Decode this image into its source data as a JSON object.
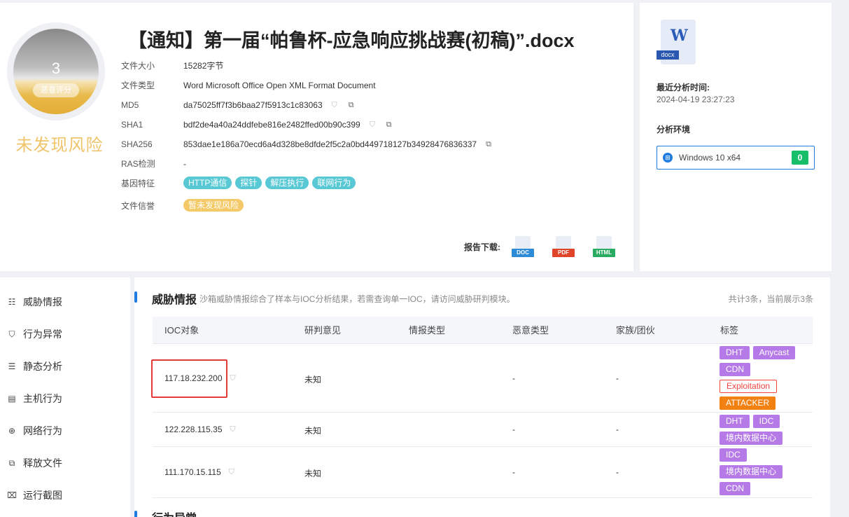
{
  "score": {
    "value": "3",
    "tag": "恶意评分",
    "verdict": "未发现风险"
  },
  "file": {
    "title": "【通知】第一届“帕鲁杯-应急响应挑战赛(初稿)”.docx",
    "rows": [
      {
        "label": "文件大小",
        "value": "15282字节"
      },
      {
        "label": "文件类型",
        "value": "Word Microsoft Office Open XML Format Document"
      },
      {
        "label": "MD5",
        "value": "da75025ff7f3b6baa27f5913c1c83063"
      },
      {
        "label": "SHA1",
        "value": "bdf2de4a40a24ddfebe816e2482ffed00b90c399"
      },
      {
        "label": "SHA256",
        "value": "853dae1e186a70ecd6a4d328be8dfde2f5c2a0bd449718127b34928476836337"
      },
      {
        "label": "RAS检测",
        "value": "-"
      }
    ],
    "gene_label": "基因特征",
    "gene_tags": [
      "HTTP通信",
      "探针",
      "解压执行",
      "联网行为"
    ],
    "reputation_label": "文件信誉",
    "reputation_tag": "暂未发现风险"
  },
  "download": {
    "label": "报告下载:",
    "formats": [
      {
        "name": "DOC",
        "color": "#2e8bd6"
      },
      {
        "name": "PDF",
        "color": "#e0452a"
      },
      {
        "name": "HTML",
        "color": "#2aab62"
      }
    ]
  },
  "right": {
    "doc_letter": "W",
    "doc_ext": "docx",
    "recent_label": "最近分析时间:",
    "recent_time": "2024-04-19 23:27:23",
    "env_label": "分析环境",
    "env_name": "Windows 10 x64",
    "env_count": "0"
  },
  "sidebar": {
    "items": [
      {
        "label": "威胁情报",
        "icon": "threat-intel-icon",
        "glyph": "☷"
      },
      {
        "label": "行为异常",
        "icon": "shield-icon",
        "glyph": "⛉"
      },
      {
        "label": "静态分析",
        "icon": "static-analysis-icon",
        "glyph": "☰"
      },
      {
        "label": "主机行为",
        "icon": "host-icon",
        "glyph": "▤"
      },
      {
        "label": "网络行为",
        "icon": "network-icon",
        "glyph": "⊕"
      },
      {
        "label": "释放文件",
        "icon": "release-file-icon",
        "glyph": "⧉"
      },
      {
        "label": "运行截图",
        "icon": "screenshot-icon",
        "glyph": "⌧"
      }
    ]
  },
  "threat": {
    "title": "威胁情报",
    "desc": "沙箱威胁情报综合了样本与IOC分析结果，若需查询单一IOC，请访问威胁研判模块。",
    "count": "共计3条，当前展示3条",
    "columns": [
      "IOC对象",
      "研判意见",
      "情报类型",
      "恶意类型",
      "家族/团伙",
      "标签"
    ],
    "rows": [
      {
        "ioc": "117.18.232.200",
        "opinion": "未知",
        "intel": "",
        "malicious": "-",
        "family": "-",
        "tags": [
          {
            "text": "DHT",
            "style": "purple"
          },
          {
            "text": "Anycast",
            "style": "purple"
          },
          {
            "text": "CDN",
            "style": "purple"
          },
          {
            "text": "Exploitation",
            "style": "outline"
          },
          {
            "text": "ATTACKER",
            "style": "orange"
          }
        ]
      },
      {
        "ioc": "122.228.115.35",
        "opinion": "未知",
        "intel": "",
        "malicious": "-",
        "family": "-",
        "tags": [
          {
            "text": "DHT",
            "style": "purple"
          },
          {
            "text": "IDC",
            "style": "purple"
          },
          {
            "text": "境内数据中心",
            "style": "purple"
          }
        ]
      },
      {
        "ioc": "111.170.15.115",
        "opinion": "未知",
        "intel": "",
        "malicious": "-",
        "family": "-",
        "tags": [
          {
            "text": "IDC",
            "style": "purple"
          },
          {
            "text": "境内数据中心",
            "style": "purple"
          },
          {
            "text": "CDN",
            "style": "purple"
          }
        ]
      }
    ]
  },
  "behavior": {
    "title": "行为异常"
  }
}
